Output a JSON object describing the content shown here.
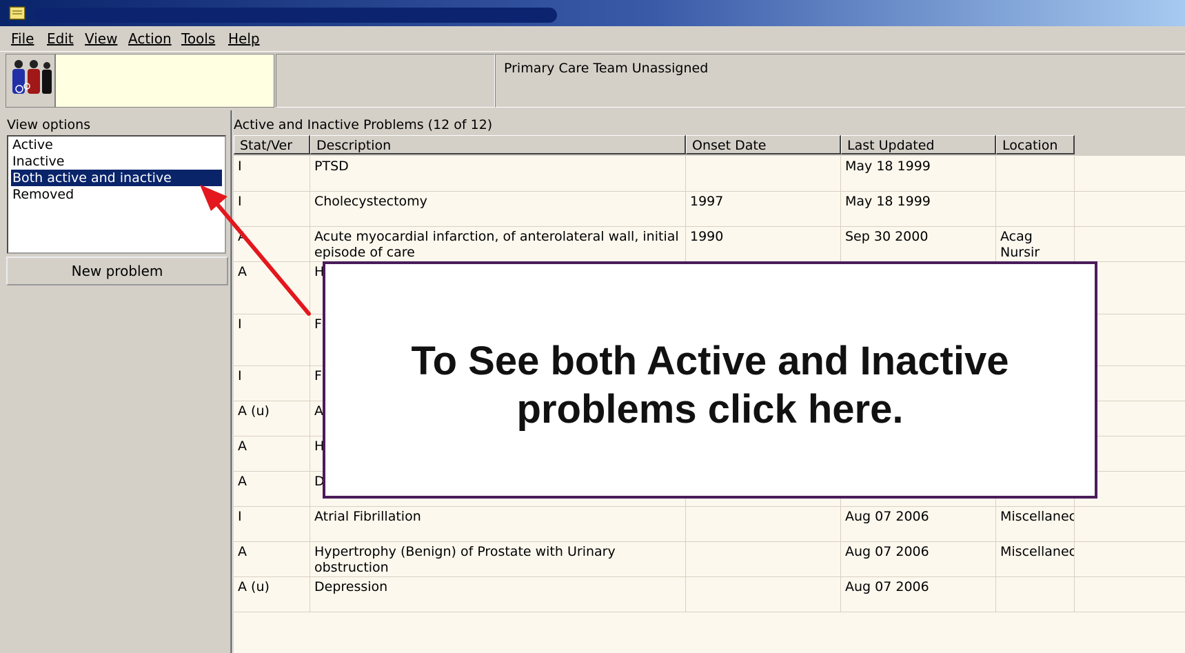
{
  "menu": [
    "File",
    "Edit",
    "View",
    "Action",
    "Tools",
    "Help"
  ],
  "header": {
    "team_text": "Primary Care Team Unassigned"
  },
  "view_options": {
    "label": "View options",
    "items": [
      {
        "label": "Active",
        "selected": false
      },
      {
        "label": "Inactive",
        "selected": false
      },
      {
        "label": "Both active and inactive",
        "selected": true
      },
      {
        "label": "Removed",
        "selected": false
      }
    ],
    "new_problem_label": "New problem"
  },
  "problems": {
    "title": "Active and Inactive Problems  (12 of 12)",
    "columns": [
      "Stat/Ver",
      "Description",
      "Onset Date",
      "Last Updated",
      "Location"
    ],
    "rows": [
      {
        "stat": "I",
        "desc": "PTSD",
        "onset": "",
        "updated": "May 18 1999",
        "location": ""
      },
      {
        "stat": "I",
        "desc": "Cholecystectomy",
        "onset": "1997",
        "updated": "May 18 1999",
        "location": ""
      },
      {
        "stat": "A",
        "desc": "Acute myocardial infarction, of anterolateral wall, initial episode of care",
        "onset": "1990",
        "updated": "Sep 30 2000",
        "location": "Acag Nursir"
      },
      {
        "stat": "A",
        "desc": "H",
        "onset": "",
        "updated": "",
        "location": ""
      },
      {
        "stat": "I",
        "desc": "F o",
        "onset": "",
        "updated": "",
        "location": ""
      },
      {
        "stat": "I",
        "desc": "F",
        "onset": "",
        "updated": "",
        "location": ""
      },
      {
        "stat": "A  (u)",
        "desc": "A",
        "onset": "",
        "updated": "",
        "location": ""
      },
      {
        "stat": "A",
        "desc": "H",
        "onset": "",
        "updated": "",
        "location": ""
      },
      {
        "stat": "A",
        "desc": "D",
        "onset": "",
        "updated": "",
        "location": ""
      },
      {
        "stat": "I",
        "desc": "Atrial Fibrillation",
        "onset": "",
        "updated": "Aug 07 2006",
        "location": "Miscellanec"
      },
      {
        "stat": "A",
        "desc": "Hypertrophy (Benign) of Prostate with Urinary obstruction",
        "onset": "",
        "updated": "Aug 07 2006",
        "location": "Miscellanec"
      },
      {
        "stat": "A  (u)",
        "desc": "Depression",
        "onset": "",
        "updated": "Aug 07 2006",
        "location": ""
      }
    ]
  },
  "callout": {
    "line1": "To See both Active and Inactive",
    "line2": "problems click here."
  },
  "colors": {
    "selection": "#0a246a",
    "callout_border": "#4b1c5a",
    "arrow": "#e3171d"
  }
}
